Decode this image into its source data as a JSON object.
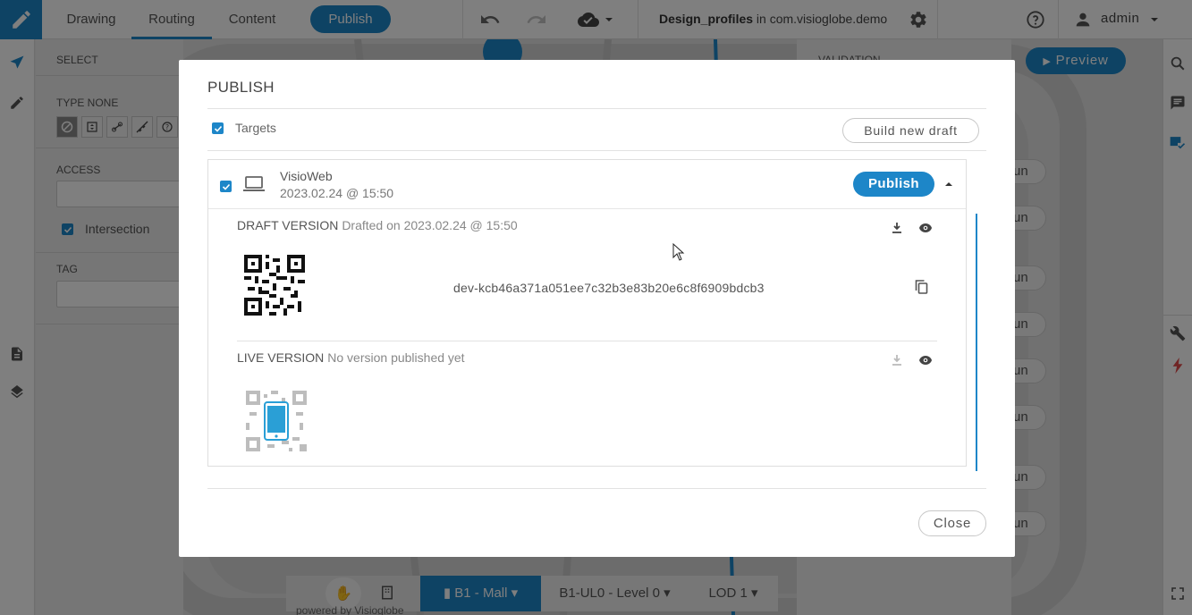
{
  "topbar": {
    "tabs": [
      "Drawing",
      "Routing",
      "Content"
    ],
    "active_tab": "Routing",
    "publish_label": "Publish",
    "project_name": "Design_profiles",
    "project_in": " in com.visioglobe.demo",
    "user_name": "admin"
  },
  "left_panel": {
    "select_label": "SELECT",
    "type_label": "TYPE NONE",
    "access_label": "ACCESS",
    "intersection_label": "Intersection",
    "tag_label": "TAG"
  },
  "right_panel": {
    "validation_label": "VALIDATION",
    "preview_label": "Preview",
    "ghost_button_label": "un"
  },
  "floor_bar": {
    "building": "B1 - Mall",
    "level": "B1-UL0 - Level 0",
    "lod": "LOD 1",
    "powered_by": "powered by Visioglobe"
  },
  "modal": {
    "title": "PUBLISH",
    "targets_label": "Targets",
    "build_draft_label": "Build new draft",
    "close_label": "Close",
    "target": {
      "name": "VisioWeb",
      "date": "2023.02.24 @ 15:50",
      "publish_label": "Publish"
    },
    "draft": {
      "title": "DRAFT VERSION",
      "subtitle": "Drafted on 2023.02.24 @ 15:50",
      "hash": "dev-kcb46a371a051ee7c32b3e83b20e6c8f6909bdcb3"
    },
    "live": {
      "title": "LIVE VERSION",
      "subtitle": "No version published yet"
    }
  },
  "colors": {
    "accent": "#1d86c8",
    "overlay": "rgba(0,0,0,0.5)"
  },
  "icons": [
    "pencil-icon",
    "undo-icon",
    "redo-icon",
    "cloud-check-icon",
    "gear-icon",
    "help-icon",
    "user-icon",
    "laptop-icon",
    "download-icon",
    "eye-icon",
    "copy-icon",
    "qr-code",
    "phone-icon"
  ]
}
